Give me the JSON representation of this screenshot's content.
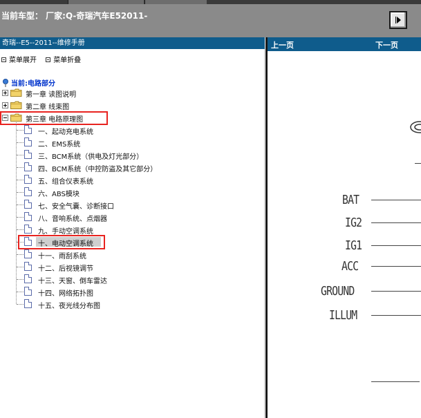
{
  "header": {
    "title": "当前车型： 厂家:Q-奇瑞汽车E52011-",
    "nav_button_icon": "next-page-icon"
  },
  "left_panel": {
    "manual_title": "奇瑞--E5--2011--维修手册",
    "menu": {
      "expand_label": "菜单展开",
      "collapse_label": "菜单折叠"
    },
    "current_label": "当前:电路部分",
    "chapters": [
      {
        "label": "第一章 读图说明",
        "expanded": false
      },
      {
        "label": "第二章 线束图",
        "expanded": false
      },
      {
        "label": "第三章 电路原理图",
        "expanded": true
      }
    ],
    "items": [
      "一、起动充电系统",
      "二、EMS系统",
      "三、BCM系统（供电及灯光部分）",
      "四、BCM系统（中控防盗及其它部分）",
      "五、组合仪表系统",
      "六、ABS模块",
      "七、安全气囊、诊断接口",
      "八、音响系统、点烟器",
      "九、手动空调系统",
      "十、电动空调系统",
      "十一、雨刮系统",
      "十二、后视镜调节",
      "十三、天窗、倒车雷达",
      "十四、网络拓扑图",
      "十五、夜光线分布图"
    ],
    "selected_item": "十、电动空调系统",
    "highlight_color": "#e8231f",
    "bar_color": "#0f5c8c"
  },
  "right_panel": {
    "prev_label": "上一页",
    "next_label": "下一页",
    "pins": [
      "BAT",
      "IG2",
      "IG1",
      "ACC",
      "GROUND",
      "ILLUM"
    ]
  }
}
